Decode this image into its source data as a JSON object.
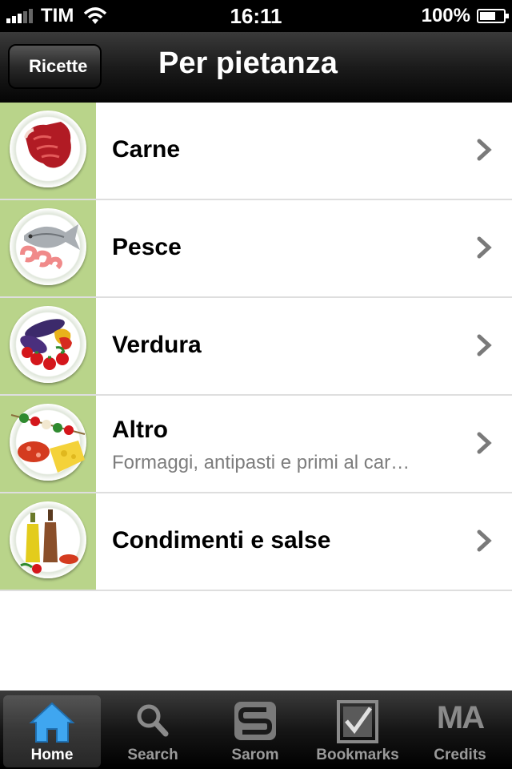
{
  "status_bar": {
    "carrier": "TIM",
    "time": "16:11",
    "battery": "100%"
  },
  "navbar": {
    "back_label": "Ricette",
    "title": "Per pietanza"
  },
  "categories": [
    {
      "title": "Carne",
      "subtitle": "",
      "icon": "meat-plate-icon"
    },
    {
      "title": "Pesce",
      "subtitle": "",
      "icon": "fish-plate-icon"
    },
    {
      "title": "Verdura",
      "subtitle": "",
      "icon": "vegetables-plate-icon"
    },
    {
      "title": "Altro",
      "subtitle": "Formaggi, antipasti e primi al car…",
      "icon": "cheese-skewer-plate-icon"
    },
    {
      "title": "Condimenti e salse",
      "subtitle": "",
      "icon": "oil-vinegar-plate-icon"
    }
  ],
  "tabbar": {
    "tabs": [
      {
        "label": "Home",
        "icon": "home-icon",
        "active": true
      },
      {
        "label": "Search",
        "icon": "search-icon",
        "active": false
      },
      {
        "label": "Sarom",
        "icon": "sarom-logo-icon",
        "active": false
      },
      {
        "label": "Bookmarks",
        "icon": "bookmarks-icon",
        "active": false
      },
      {
        "label": "Credits",
        "icon": "ma-logo-icon",
        "logo_text": "MA",
        "active": false
      }
    ]
  },
  "colors": {
    "thumb_background": "#b9d48a",
    "home_icon": "#3fa6f0"
  }
}
